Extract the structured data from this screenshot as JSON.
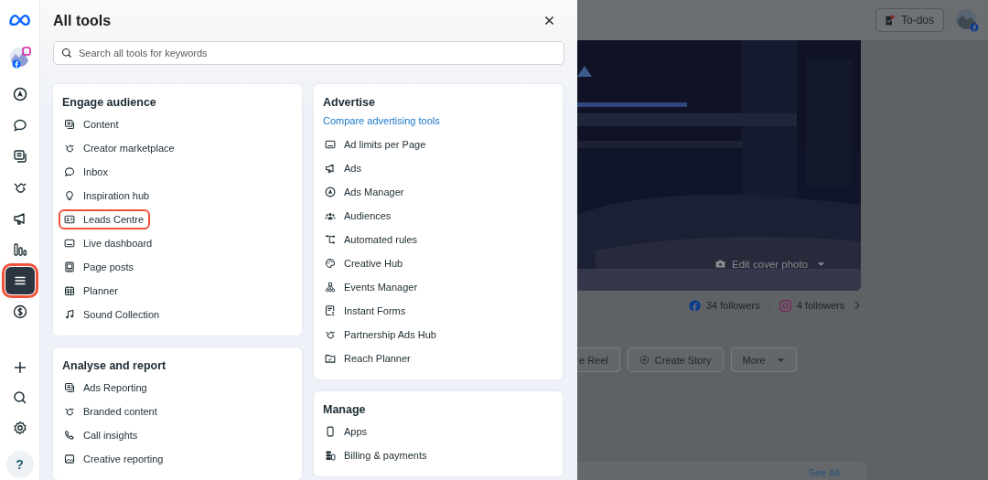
{
  "rail": {
    "items": [
      {
        "selected": false
      },
      {
        "selected": false
      },
      {
        "selected": false
      },
      {
        "selected": false
      },
      {
        "selected": false
      },
      {
        "selected": false
      },
      {
        "selected": true
      },
      {
        "selected": false
      }
    ],
    "help_label": "?"
  },
  "panel": {
    "title": "All tools",
    "search": {
      "placeholder": "Search all tools for keywords"
    },
    "columns": [
      {
        "sections": [
          {
            "title": "Engage audience",
            "items": [
              {
                "label": "Content",
                "highlighted": false
              },
              {
                "label": "Creator marketplace",
                "highlighted": false
              },
              {
                "label": "Inbox",
                "highlighted": false
              },
              {
                "label": "Inspiration hub",
                "highlighted": false
              },
              {
                "label": "Leads Centre",
                "highlighted": true
              },
              {
                "label": "Live dashboard",
                "highlighted": false
              },
              {
                "label": "Page posts",
                "highlighted": false
              },
              {
                "label": "Planner",
                "highlighted": false
              },
              {
                "label": "Sound Collection",
                "highlighted": false
              }
            ]
          },
          {
            "title": "Analyse and report",
            "items": [
              {
                "label": "Ads Reporting",
                "highlighted": false
              },
              {
                "label": "Branded content",
                "highlighted": false
              },
              {
                "label": "Call insights",
                "highlighted": false
              },
              {
                "label": "Creative reporting",
                "highlighted": false
              }
            ]
          }
        ]
      },
      {
        "sections": [
          {
            "title": "Advertise",
            "link": "Compare advertising tools",
            "items": [
              {
                "label": "Ad limits per Page",
                "highlighted": false
              },
              {
                "label": "Ads",
                "highlighted": false
              },
              {
                "label": "Ads Manager",
                "highlighted": false
              },
              {
                "label": "Audiences",
                "highlighted": false
              },
              {
                "label": "Automated rules",
                "highlighted": false
              },
              {
                "label": "Creative Hub",
                "highlighted": false
              },
              {
                "label": "Events Manager",
                "highlighted": false
              },
              {
                "label": "Instant Forms",
                "highlighted": false
              },
              {
                "label": "Partnership Ads Hub",
                "highlighted": false
              },
              {
                "label": "Reach Planner",
                "highlighted": false
              }
            ]
          },
          {
            "title": "Manage",
            "items": [
              {
                "label": "Apps",
                "highlighted": false
              },
              {
                "label": "Billing & payments",
                "highlighted": false
              }
            ]
          }
        ]
      }
    ]
  },
  "page": {
    "todos_label": "To-dos",
    "cover": {
      "kind": "picture",
      "edit_label": "Edit cover photo"
    },
    "followers": [
      {
        "kind": "facebook",
        "label": "34 followers"
      },
      {
        "kind": "instagram",
        "label": "4 followers"
      }
    ],
    "actions": [
      {
        "kind": "plain",
        "label": "e Reel"
      },
      {
        "kind": "story",
        "label": "Create Story"
      },
      {
        "kind": "menu",
        "label": "More"
      }
    ],
    "see_all": "See All"
  }
}
